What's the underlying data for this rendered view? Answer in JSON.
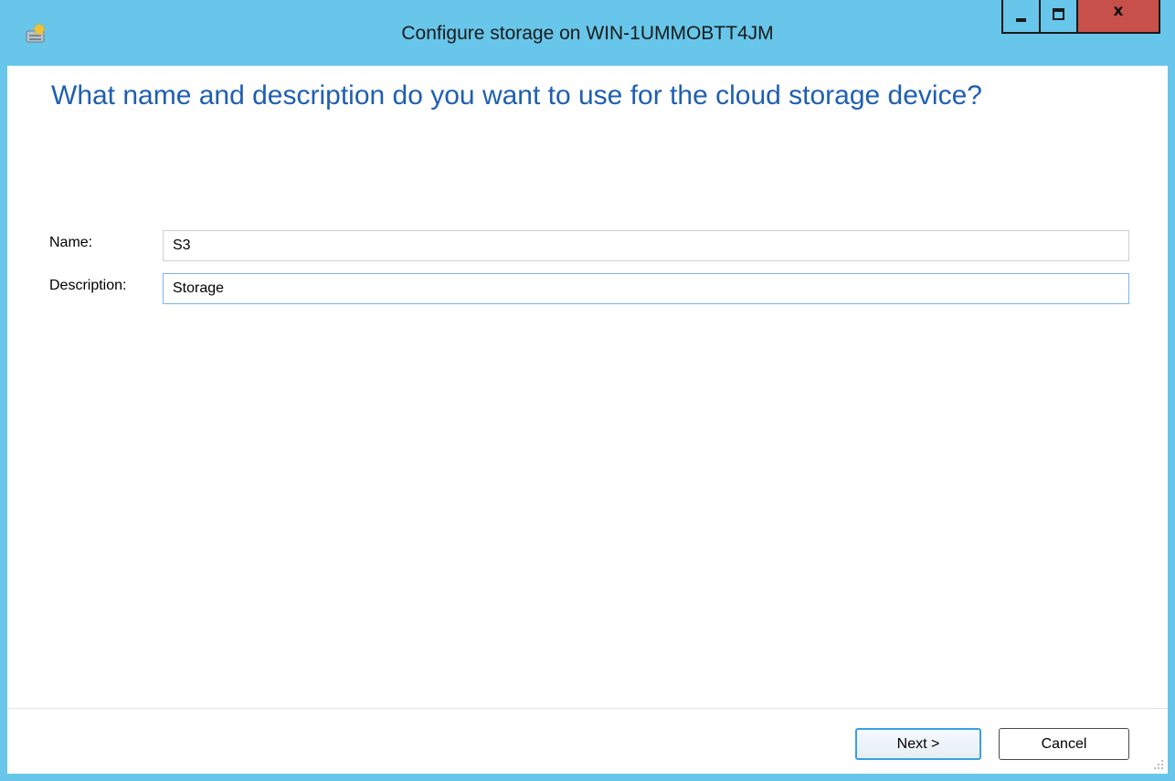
{
  "window": {
    "title": "Configure storage on WIN-1UMMOBTT4JM",
    "close_label": "x"
  },
  "page": {
    "heading": "What name and description do you want to use for the cloud storage device?"
  },
  "form": {
    "name_label": "Name:",
    "name_value": "S3",
    "description_label": "Description:",
    "description_value": "Storage"
  },
  "footer": {
    "next_label": "Next >",
    "cancel_label": "Cancel"
  },
  "colors": {
    "titlebar": "#67c6ea",
    "close_button": "#c7504a",
    "heading": "#1f5fb1",
    "focus_border": "#3c9fdf"
  }
}
